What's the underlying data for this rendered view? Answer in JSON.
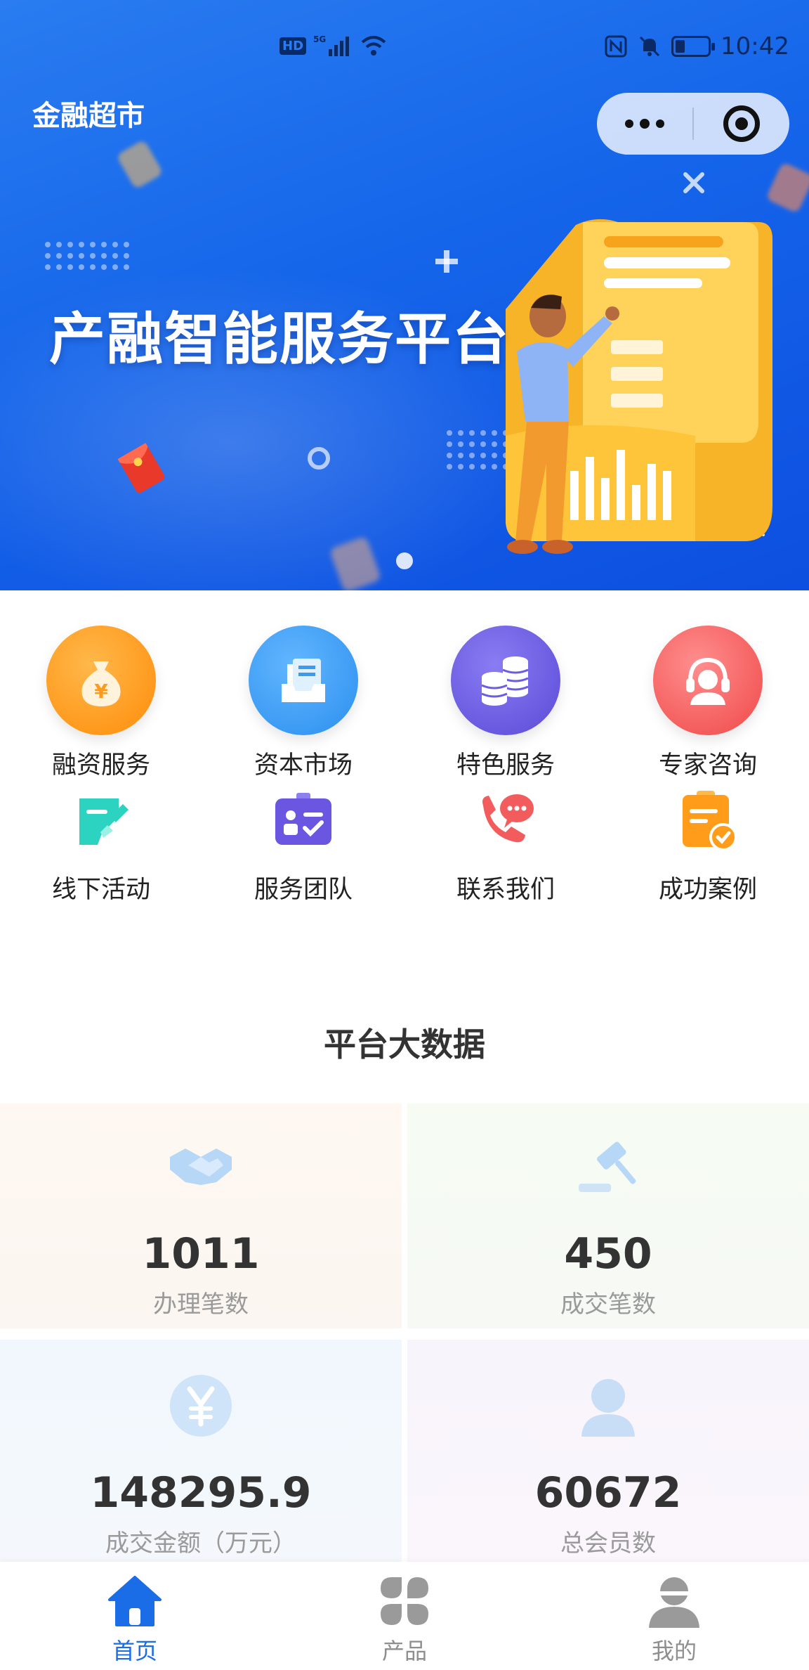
{
  "status_bar": {
    "left_badges": [
      "HD",
      "5G"
    ],
    "time": "10:42",
    "battery_level": 0.3
  },
  "header": {
    "title": "金融超市"
  },
  "banner": {
    "headline": "产融智能服务平台",
    "active_slide": 1,
    "slide_count": 1
  },
  "menu": {
    "row1": [
      {
        "label": "融资服务",
        "icon": "money-bag-icon",
        "color": "#ff9a1a"
      },
      {
        "label": "资本市场",
        "icon": "document-tray-icon",
        "color": "#3a9cf0"
      },
      {
        "label": "特色服务",
        "icon": "coin-stack-icon",
        "color": "#6b5ce6"
      },
      {
        "label": "专家咨询",
        "icon": "headset-icon",
        "color": "#f25a5a"
      }
    ],
    "row2": [
      {
        "label": "线下活动",
        "icon": "edit-note-icon",
        "color": "#2cd3c0"
      },
      {
        "label": "服务团队",
        "icon": "id-card-icon",
        "color": "#6a56e0"
      },
      {
        "label": "联系我们",
        "icon": "phone-chat-icon",
        "color": "#f25c5c"
      },
      {
        "label": "成功案例",
        "icon": "clipboard-check-icon",
        "color": "#ff9c1a"
      }
    ]
  },
  "stats": {
    "title": "平台大数据",
    "items": [
      {
        "value": "1011",
        "label": "办理笔数",
        "icon": "handshake-icon",
        "color": "#9cc8f4"
      },
      {
        "value": "450",
        "label": "成交笔数",
        "icon": "gavel-icon",
        "color": "#a8cdef"
      },
      {
        "value": "148295.9",
        "label": "成交金额（万元）",
        "icon": "yen-icon",
        "color": "#a8cdf0"
      },
      {
        "value": "60672",
        "label": "总会员数",
        "icon": "user-icon",
        "color": "#a8cdf0"
      }
    ]
  },
  "tab_bar": {
    "tabs": [
      {
        "label": "首页",
        "icon": "home-icon",
        "active": true
      },
      {
        "label": "产品",
        "icon": "grid-icon",
        "active": false
      },
      {
        "label": "我的",
        "icon": "profile-icon",
        "active": false
      }
    ],
    "active_color": "#1a6de6",
    "inactive_color": "#8e8e8e"
  }
}
